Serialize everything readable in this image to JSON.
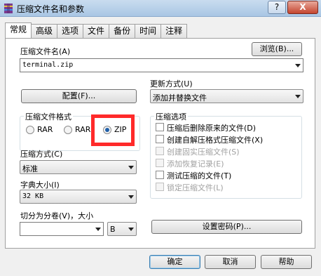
{
  "window": {
    "title": "压缩文件名和参数",
    "help_button": "?",
    "close_button": "X"
  },
  "tabs": [
    {
      "label": "常规",
      "active": true
    },
    {
      "label": "高级",
      "active": false
    },
    {
      "label": "选项",
      "active": false
    },
    {
      "label": "文件",
      "active": false
    },
    {
      "label": "备份",
      "active": false
    },
    {
      "label": "时间",
      "active": false
    },
    {
      "label": "注释",
      "active": false
    }
  ],
  "archive_name": {
    "label": "压缩文件名(A)",
    "value": "terminal.zip",
    "browse_label": "浏览(B)..."
  },
  "update_mode": {
    "label": "更新方式(U)",
    "value": "添加并替换文件"
  },
  "profiles_button": "配置(F)...",
  "archive_format": {
    "title": "压缩文件格式",
    "options": [
      {
        "label": "RAR",
        "selected": false
      },
      {
        "label": "RAR5",
        "selected": false
      },
      {
        "label": "ZIP",
        "selected": true
      }
    ]
  },
  "compression_method": {
    "label": "压缩方式(C)",
    "value": "标准"
  },
  "dictionary_size": {
    "label": "字典大小(I)",
    "value": "32 KB"
  },
  "split_volumes": {
    "label": "切分为分卷(V)，大小",
    "value": "",
    "unit": "B"
  },
  "archiving_options": {
    "title": "压缩选项",
    "items": [
      {
        "label": "压缩后删除原来的文件(D)",
        "checked": false,
        "enabled": true
      },
      {
        "label": "创建自解压格式压缩文件(X)",
        "checked": false,
        "enabled": true
      },
      {
        "label": "创建固实压缩文件(S)",
        "checked": false,
        "enabled": false
      },
      {
        "label": "添加恢复记录(E)",
        "checked": false,
        "enabled": false
      },
      {
        "label": "测试压缩的文件(T)",
        "checked": false,
        "enabled": true
      },
      {
        "label": "锁定压缩文件(L)",
        "checked": false,
        "enabled": false
      }
    ]
  },
  "set_password_button": "设置密码(P)...",
  "footer": {
    "ok": "确定",
    "cancel": "取消",
    "help": "帮助"
  },
  "colors": {
    "highlight_box": "#ff2a2a",
    "titlebar": "#c9dcef",
    "accent": "#1f5fa8"
  }
}
